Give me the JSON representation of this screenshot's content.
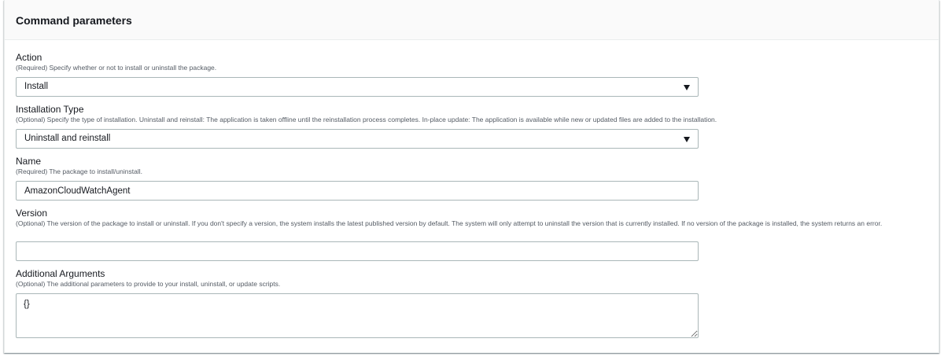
{
  "panel": {
    "title": "Command parameters"
  },
  "fields": {
    "action": {
      "label": "Action",
      "description": "(Required) Specify whether or not to install or uninstall the package.",
      "value": "Install"
    },
    "installation_type": {
      "label": "Installation Type",
      "description": "(Optional) Specify the type of installation. Uninstall and reinstall: The application is taken offline until the reinstallation process completes. In-place update: The application is available while new or updated files are added to the installation.",
      "value": "Uninstall and reinstall"
    },
    "name": {
      "label": "Name",
      "description": "(Required) The package to install/uninstall.",
      "value": "AmazonCloudWatchAgent"
    },
    "version": {
      "label": "Version",
      "description": "(Optional) The version of the package to install or uninstall. If you don't specify a version, the system installs the latest published version by default. The system will only attempt to uninstall the version that is currently installed. If no version of the package is installed, the system returns an error.",
      "value": ""
    },
    "additional_arguments": {
      "label": "Additional Arguments",
      "description": "(Optional) The additional parameters to provide to your install, uninstall, or update scripts.",
      "value": "{}"
    }
  }
}
